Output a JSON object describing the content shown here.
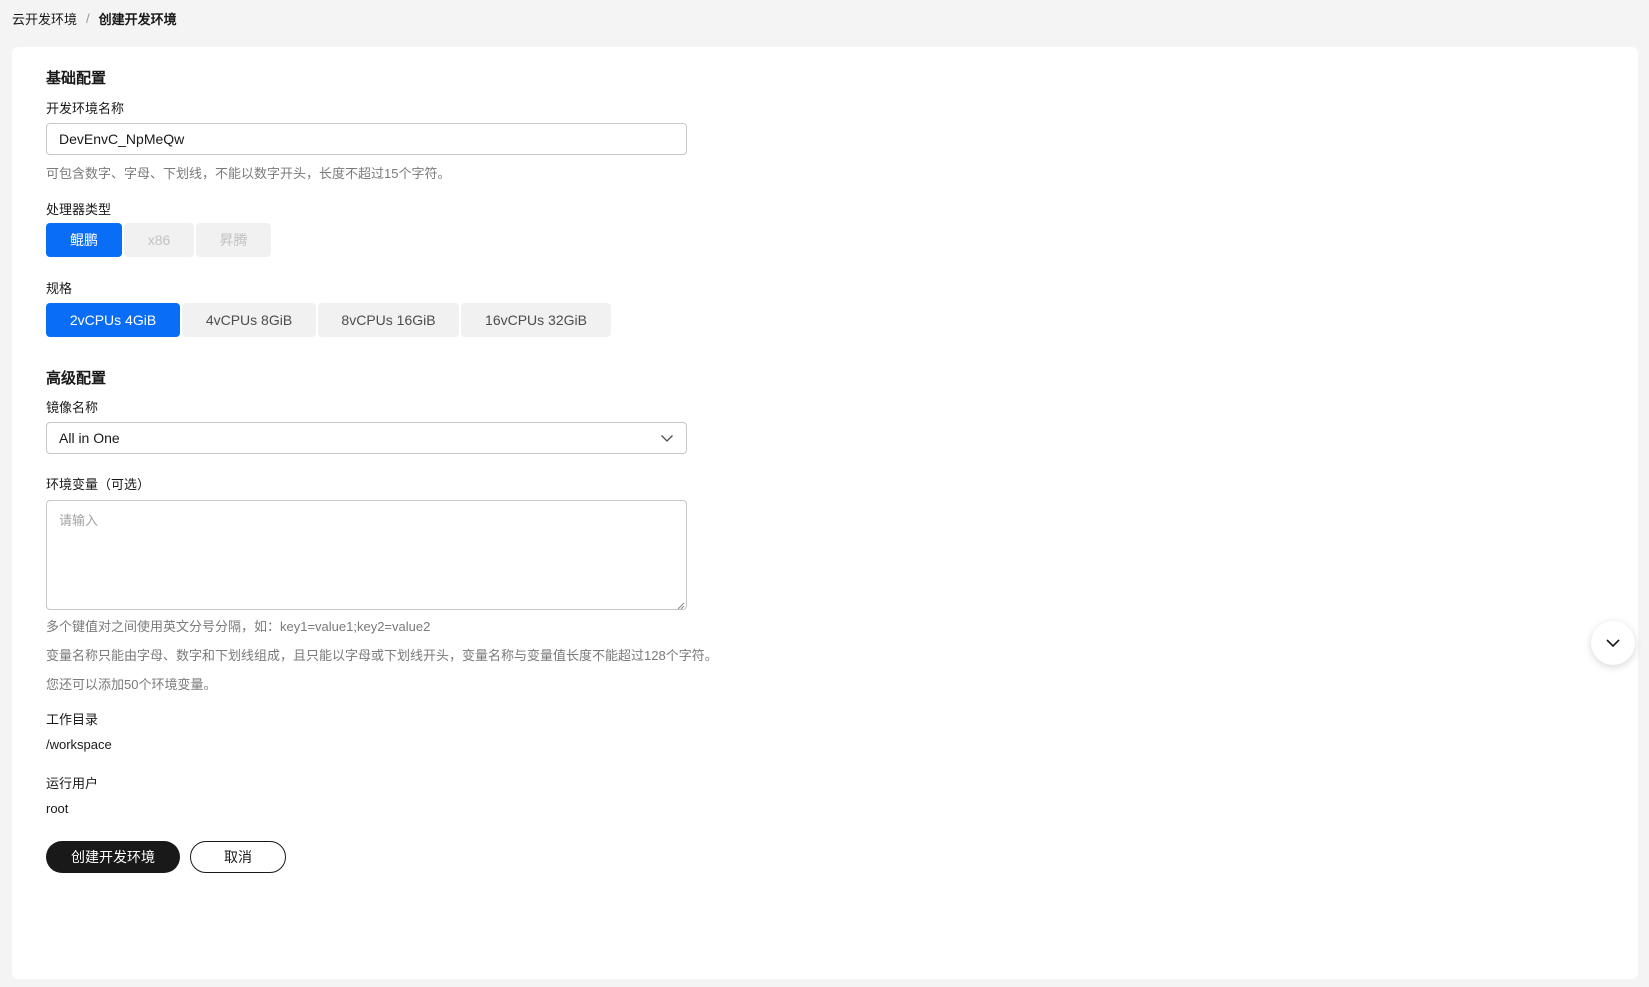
{
  "breadcrumb": {
    "parent": "云开发环境",
    "separator": "/",
    "current": "创建开发环境"
  },
  "basic": {
    "section_title": "基础配置",
    "name_label": "开发环境名称",
    "name_value": "DevEnvC_NpMeQw",
    "name_hint": "可包含数字、字母、下划线，不能以数字开头，长度不超过15个字符。",
    "processor_label": "处理器类型",
    "processor_options": [
      {
        "label": "鲲鹏",
        "state": "active"
      },
      {
        "label": "x86",
        "state": "disabled"
      },
      {
        "label": "昇腾",
        "state": "disabled"
      }
    ],
    "spec_label": "规格",
    "spec_options": [
      {
        "label": "2vCPUs 4GiB",
        "state": "active"
      },
      {
        "label": "4vCPUs 8GiB",
        "state": "normal"
      },
      {
        "label": "8vCPUs 16GiB",
        "state": "normal"
      },
      {
        "label": "16vCPUs 32GiB",
        "state": "normal"
      }
    ]
  },
  "advanced": {
    "section_title": "高级配置",
    "image_label": "镜像名称",
    "image_value": "All in One",
    "env_label": "环境变量（可选）",
    "env_placeholder": "请输入",
    "env_hint_1": "多个键值对之间使用英文分号分隔，如：key1=value1;key2=value2",
    "env_hint_2": "变量名称只能由字母、数字和下划线组成，且只能以字母或下划线开头，变量名称与变量值长度不能超过128个字符。",
    "env_hint_3": "您还可以添加50个环境变量。",
    "workdir_label": "工作目录",
    "workdir_value": "/workspace",
    "user_label": "运行用户",
    "user_value": "root"
  },
  "actions": {
    "create_label": "创建开发环境",
    "cancel_label": "取消"
  },
  "colors": {
    "primary": "#0a6df5",
    "dark_button": "#191919",
    "page_bg": "#f4f4f4"
  },
  "icons": {
    "select_chevron": "chevron-down-icon",
    "scroll_button": "chevron-down-icon"
  }
}
